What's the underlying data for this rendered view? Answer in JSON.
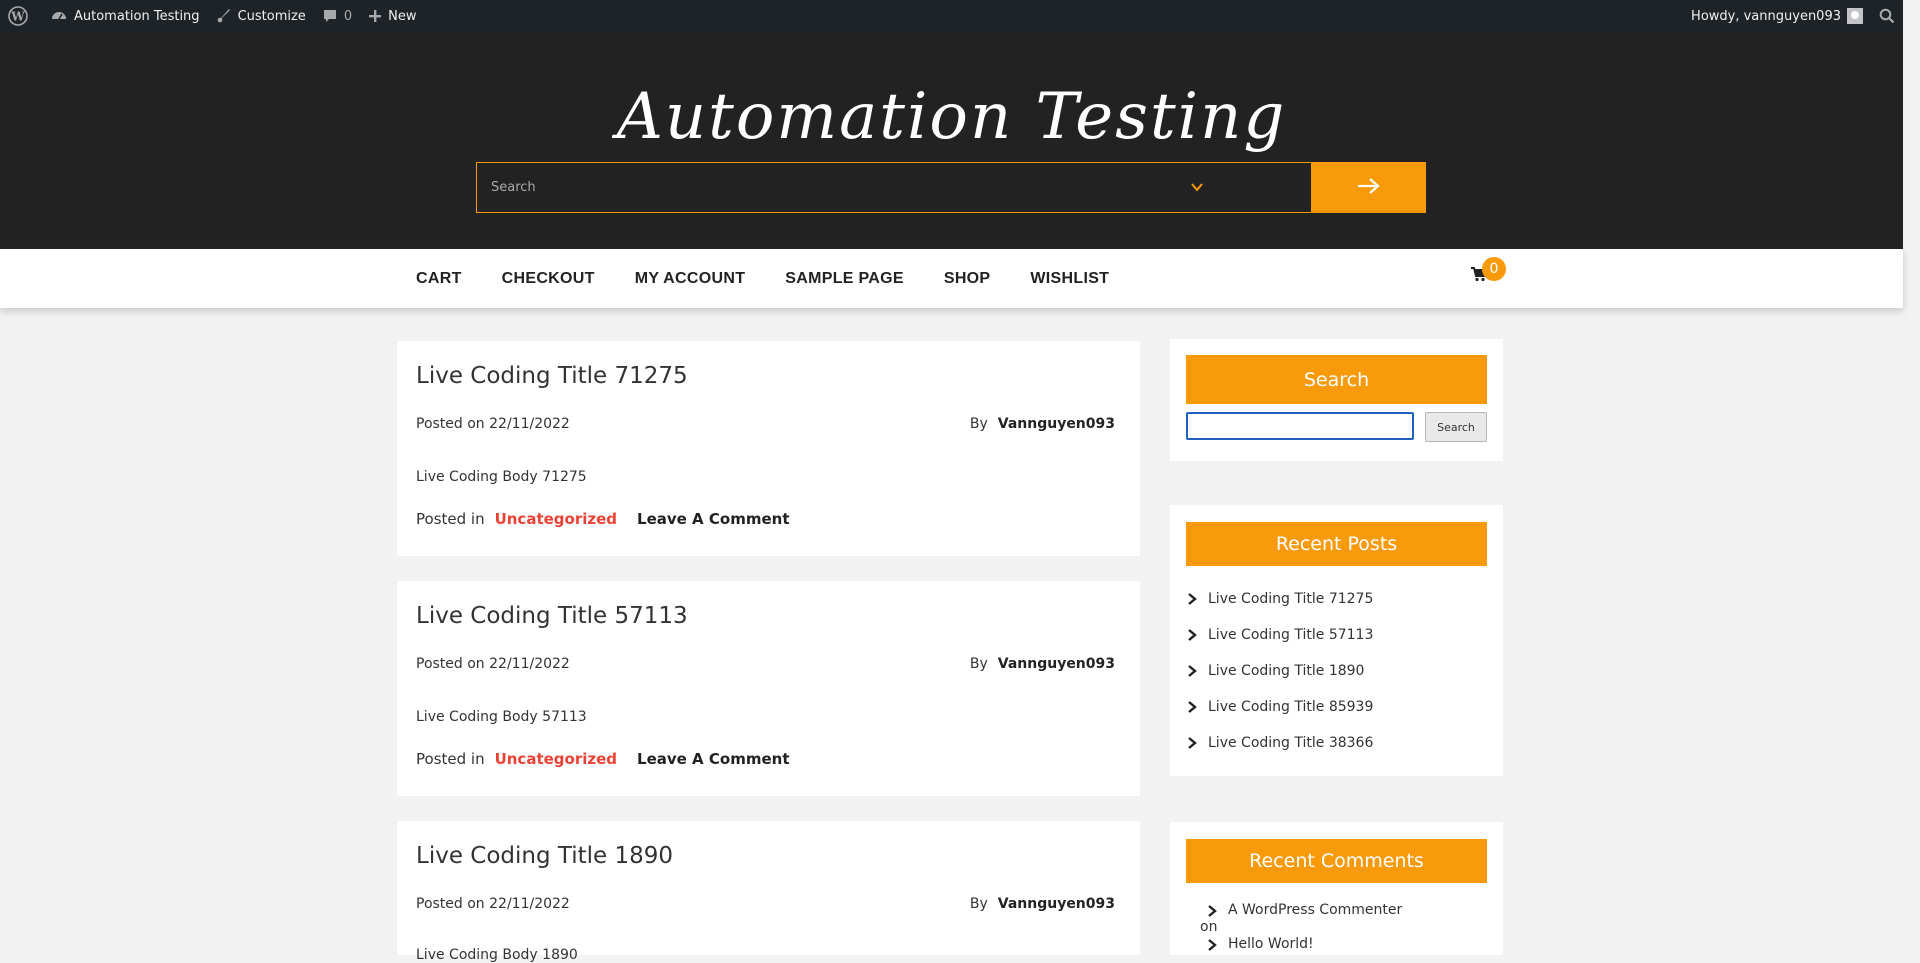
{
  "adminbar": {
    "site_name": "Automation Testing",
    "customize": "Customize",
    "comments_count": "0",
    "new_label": "New",
    "howdy": "Howdy, vannguyen093"
  },
  "header": {
    "site_title": "Automation Testing",
    "search_placeholder": "Search"
  },
  "nav": {
    "items": [
      "CART",
      "CHECKOUT",
      "MY ACCOUNT",
      "SAMPLE PAGE",
      "SHOP",
      "WISHLIST"
    ],
    "cart_count": "0"
  },
  "posts": [
    {
      "title": "Live Coding Title 71275",
      "date": "Posted on 22/11/2022",
      "by": "By",
      "author": "Vannguyen093",
      "body": "Live Coding Body 71275",
      "posted_in": "Posted in",
      "category": "Uncategorized",
      "comment": "Leave A Comment"
    },
    {
      "title": "Live Coding Title 57113",
      "date": "Posted on 22/11/2022",
      "by": "By",
      "author": "Vannguyen093",
      "body": "Live Coding Body 57113",
      "posted_in": "Posted in",
      "category": "Uncategorized",
      "comment": "Leave A Comment"
    },
    {
      "title": "Live Coding Title 1890",
      "date": "Posted on 22/11/2022",
      "by": "By",
      "author": "Vannguyen093",
      "body": "Live Coding Body 1890"
    }
  ],
  "sidebar": {
    "search_title": "Search",
    "search_button": "Search",
    "recent_posts_title": "Recent Posts",
    "recent_posts": [
      "Live Coding Title 71275",
      "Live Coding Title 57113",
      "Live Coding Title 1890",
      "Live Coding Title 85939",
      "Live Coding Title 38366"
    ],
    "recent_comments_title": "Recent Comments",
    "recent_comment_author": "A WordPress Commenter",
    "recent_comment_on": "on",
    "recent_comment_post": "Hello World!"
  },
  "colors": {
    "accent": "#f99a0b",
    "header_bg": "#222222",
    "category": "#ea4335"
  }
}
